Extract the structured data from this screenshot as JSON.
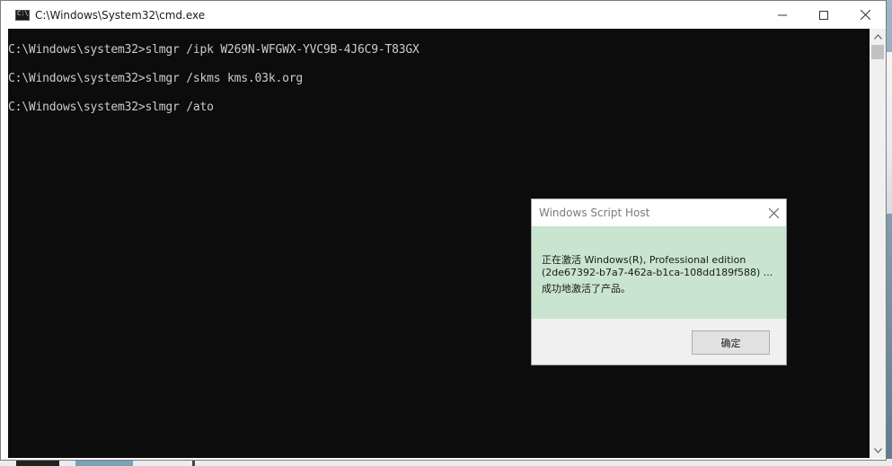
{
  "window": {
    "title": "C:\\Windows\\System32\\cmd.exe"
  },
  "console": {
    "lines": [
      "C:\\Windows\\system32>slmgr /ipk W269N-WFGWX-YVC9B-4J6C9-T83GX",
      "C:\\Windows\\system32>slmgr /skms kms.03k.org",
      "C:\\Windows\\system32>slmgr /ato"
    ]
  },
  "dialog": {
    "title": "Windows Script Host",
    "message": [
      "正在激活 Windows(R), Professional edition",
      "(2de67392-b7a7-462a-b1ca-108dd189f588) ...",
      "成功地激活了产品。"
    ],
    "ok_label": "确定"
  },
  "colors": {
    "console_bg": "#0c0c0c",
    "console_fg": "#cccccc",
    "dialog_body": "#c9e4cf"
  }
}
